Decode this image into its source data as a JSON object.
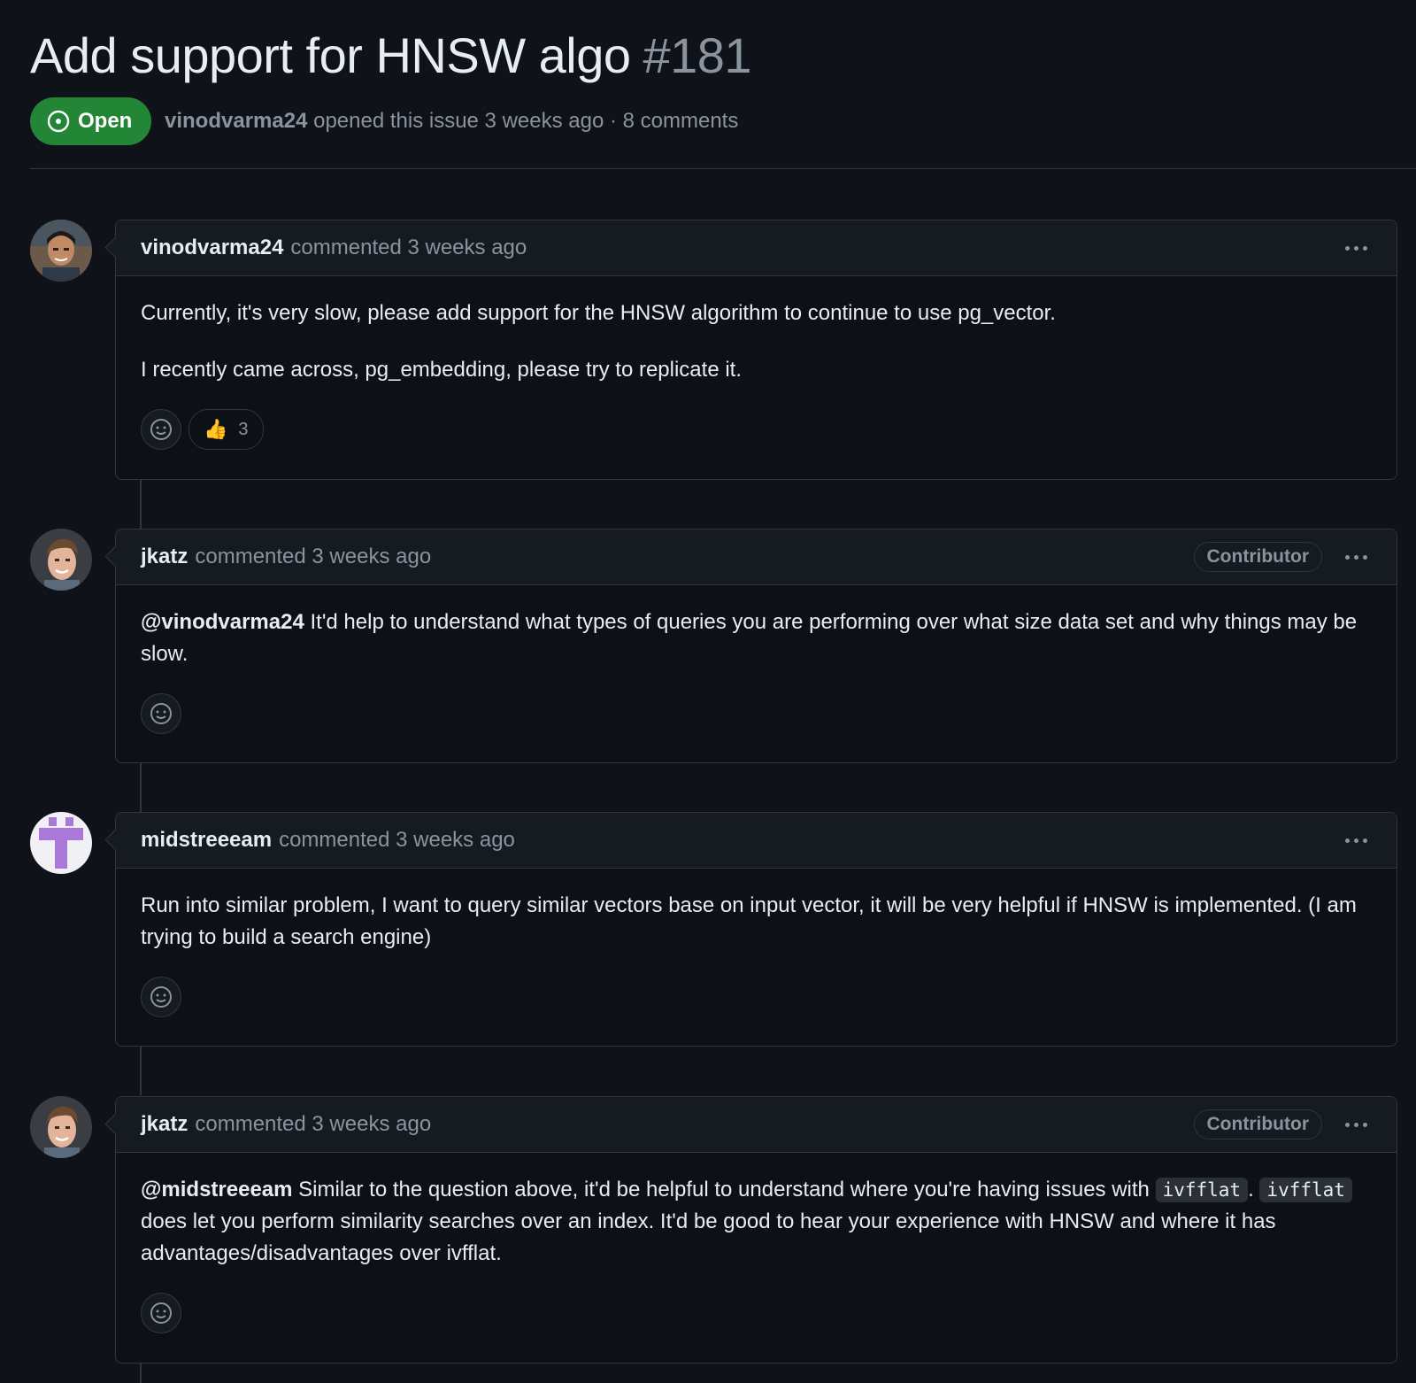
{
  "issue": {
    "title": "Add support for HNSW algo",
    "number": "#181",
    "state": "Open",
    "author": "vinodvarma24",
    "opened_text": "opened this issue 3 weeks ago · 8 comments"
  },
  "comments": [
    {
      "author": "vinodvarma24",
      "action": "commented 3 weeks ago",
      "body": [
        "Currently, it's very slow, please add support for the HNSW algorithm to continue to use pg_vector.",
        "I recently came across, pg_embedding, please try to replicate it."
      ],
      "reaction_emoji": "👍",
      "reaction_count": "3"
    },
    {
      "author": "jkatz",
      "action": "commented 3 weeks ago",
      "role": "Contributor",
      "mention": "@vinodvarma24",
      "body_text": "It'd help to understand what types of queries you are performing over what size data set and why things may be slow."
    },
    {
      "author": "midstreeeam",
      "action": "commented 3 weeks ago",
      "body_text": "Run into similar problem, I want to query similar vectors base on input vector, it will be very helpful if HNSW is implemented. (I am trying to build a search engine)"
    },
    {
      "author": "jkatz",
      "action": "commented 3 weeks ago",
      "role": "Contributor",
      "mention": "@midstreeeam",
      "text_1": "Similar to the question above, it'd be helpful to understand where you're having issues with",
      "code_1": "ivfflat",
      "text_2": ".",
      "code_2": "ivfflat",
      "text_3": "does let you perform similarity searches over an index. It'd be good to hear your experience with HNSW and where it has advantages/disadvantages over ivfflat."
    }
  ],
  "colors": {
    "background": "#0f1218",
    "open_badge": "#238636",
    "border": "#30363d",
    "muted_text": "#8b949e"
  }
}
